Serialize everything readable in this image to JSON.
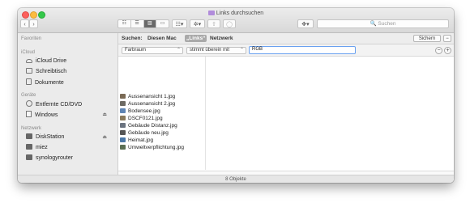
{
  "window": {
    "title": "Links durchsuchen"
  },
  "toolbar": {
    "back_label": "‹",
    "forward_label": "›",
    "view_modes": [
      "☷",
      "☰",
      "▥",
      "▭"
    ],
    "group_label": "☷▾",
    "action_label": "✲▾",
    "share_label": "⇧",
    "tag_label": "◯",
    "dropbox_label": "✥▾",
    "search_placeholder": "🔍 Suchen"
  },
  "sidebar": {
    "sections": [
      {
        "title": "Favoriten",
        "items": []
      },
      {
        "title": "iCloud",
        "items": [
          {
            "label": "iCloud Drive",
            "icon": "cloud-icon"
          },
          {
            "label": "Schreibtisch",
            "icon": "desktop-icon"
          },
          {
            "label": "Dokumente",
            "icon": "document-icon"
          }
        ]
      },
      {
        "title": "Geräte",
        "items": [
          {
            "label": "Entfernte CD/DVD",
            "icon": "disc-icon"
          },
          {
            "label": "Windows",
            "icon": "drive-icon",
            "eject": "⏏"
          }
        ]
      },
      {
        "title": "Netzwerk",
        "items": [
          {
            "label": "DiskStation",
            "icon": "server-icon",
            "eject": "⏏"
          },
          {
            "label": "miez",
            "icon": "server-icon"
          },
          {
            "label": "synologyrouter",
            "icon": "server-icon"
          }
        ]
      }
    ]
  },
  "search": {
    "label": "Suchen:",
    "scopes": [
      "Diesen Mac",
      "„Links“",
      "Netzwerk"
    ],
    "selected_scope": 1,
    "save_label": "Sichern",
    "remove_label": "−"
  },
  "criteria": {
    "attribute": "Farbraum",
    "operator": "stimmt überein mit",
    "value": "RGB",
    "minus_label": "−",
    "plus_label": "+"
  },
  "files": [
    {
      "name": "Aussenansicht 1.jpg",
      "color": "#7a6a55"
    },
    {
      "name": "Aussenansicht 2.jpg",
      "color": "#6d6a63"
    },
    {
      "name": "Bodensee.jpg",
      "color": "#5f85b4"
    },
    {
      "name": "DSCF0121.jpg",
      "color": "#8a7a5c"
    },
    {
      "name": "Gebäude Distanz.jpg",
      "color": "#6b7480"
    },
    {
      "name": "Gebäude neu.jpg",
      "color": "#565656"
    },
    {
      "name": "Heimat.jpg",
      "color": "#4b78a8"
    },
    {
      "name": "Umweltverpflichtung.jpg",
      "color": "#5b6f54"
    }
  ],
  "status": {
    "count_text": "8 Objekte"
  },
  "colors": {
    "accent": "#6aa1f0",
    "close": "#fc605c",
    "minimize": "#fdbc40",
    "maximize": "#34c84a"
  }
}
